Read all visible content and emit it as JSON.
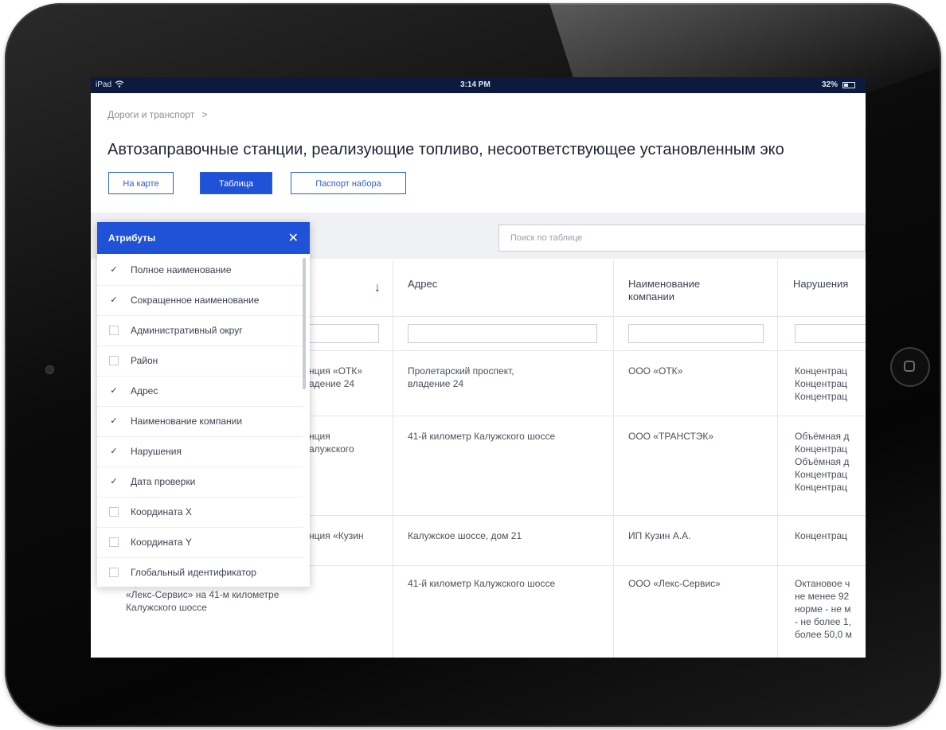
{
  "status_bar": {
    "device": "iPad",
    "wifi_icon": "wifi-icon",
    "time": "3:14 PM",
    "battery": "32%"
  },
  "breadcrumb": {
    "label": "Дороги и транспорт",
    "separator": ">"
  },
  "page_title": "Автозаправочные станции, реализующие топливо, несоответствующее установленным эко",
  "view_buttons": [
    {
      "label": "На карте",
      "active": false
    },
    {
      "label": "Таблица",
      "active": true
    },
    {
      "label": "Паспорт набора",
      "active": false
    }
  ],
  "search": {
    "placeholder": "Поиск по таблице"
  },
  "table": {
    "headers": [
      "Адрес",
      "Наименование компании",
      "Нарушения"
    ],
    "sort_icon": "arrow-down-icon",
    "rows": [
      {
        "name": "нция «ОТК»\nадение 24",
        "address": "Пролетарский проспект,\nвладение 24",
        "company": "ООО «ОТК»",
        "violations": "Концентрац\nКонцентрац\nКонцентрац"
      },
      {
        "name": "нция\nалужского",
        "address": "41-й километр Калужского шоссе",
        "company": "ООО «ТРАНСТЭК»",
        "violations": "Объёмная д\nКонцентрац\nОбъёмная д\nКонцентрац\nКонцентрац"
      },
      {
        "name": "нция «Кузин",
        "address": "Калужское шоссе, дом 21",
        "company": "ИП Кузин А.А.",
        "violations": "Концентрац"
      },
      {
        "name": "нция\n«Лекс-Сервис» на 41-м километре\nКалужского шоссе",
        "address": "41-й километр Калужского шоссе",
        "company": "ООО «Лекс-Сервис»",
        "violations": "Октановое ч\nне менее 92\nнорме - не м\n- не более 1,\nболее 50,0 м"
      }
    ]
  },
  "attributes_panel": {
    "title": "Атрибуты",
    "close_icon": "close-icon",
    "items": [
      {
        "label": "Полное наименование",
        "checked": true
      },
      {
        "label": "Сокращенное наименование",
        "checked": true
      },
      {
        "label": "Административный округ",
        "checked": false
      },
      {
        "label": "Район",
        "checked": false
      },
      {
        "label": "Адрес",
        "checked": true
      },
      {
        "label": "Наименование компании",
        "checked": true
      },
      {
        "label": "Нарушения",
        "checked": true
      },
      {
        "label": "Дата проверки",
        "checked": true
      },
      {
        "label": "Координата X",
        "checked": false
      },
      {
        "label": "Координата Y",
        "checked": false
      },
      {
        "label": "Глобальный идентификатор",
        "checked": false
      }
    ]
  },
  "colors": {
    "accent": "#1f52d6",
    "status_bar": "#0b1a3e"
  }
}
